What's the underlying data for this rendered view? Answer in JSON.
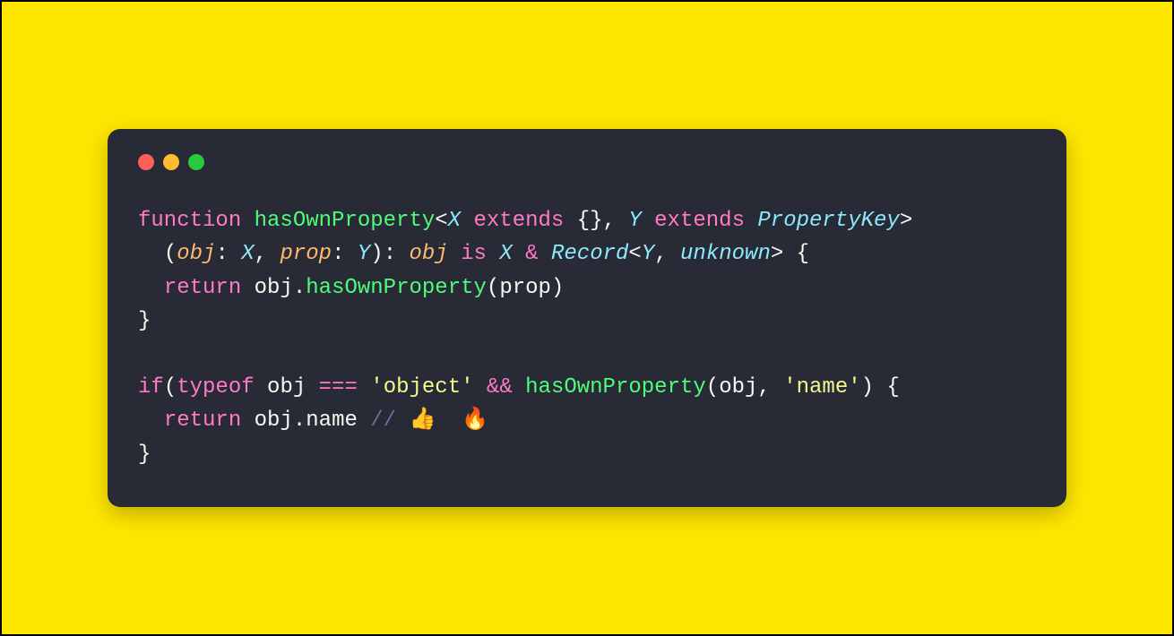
{
  "window": {
    "buttons": [
      "close",
      "minimize",
      "zoom"
    ]
  },
  "code": {
    "line1": {
      "kw_function": "function",
      "fn_name": "hasOwnProperty",
      "lt1": "<",
      "type_X": "X",
      "kw_extends1": "extends",
      "braces1": "{}",
      "comma1": ",",
      "type_Y": "Y",
      "kw_extends2": "extends",
      "type_PropertyKey": "PropertyKey",
      "gt1": ">"
    },
    "line2": {
      "indent": "  ",
      "lparen": "(",
      "var_obj": "obj",
      "colon1": ":",
      "type_X": "X",
      "comma": ",",
      "var_prop": "prop",
      "colon2": ":",
      "type_Y": "Y",
      "rparen_colon": "):",
      "var_obj2": "obj",
      "kw_is": "is",
      "type_X2": "X",
      "amp": "&",
      "type_Record": "Record",
      "lt": "<",
      "type_Y2": "Y",
      "comma2": ",",
      "type_unknown": "unknown",
      "gt": ">",
      "lbrace": "{"
    },
    "line3": {
      "indent": "  ",
      "kw_return": "return",
      "obj": "obj",
      "dot": ".",
      "method": "hasOwnProperty",
      "lparen": "(",
      "arg": "prop",
      "rparen": ")"
    },
    "line4": {
      "rbrace": "}"
    },
    "line6": {
      "kw_if": "if",
      "lparen": "(",
      "kw_typeof": "typeof",
      "obj": "obj",
      "op_eq": "===",
      "str_object": "'object'",
      "op_and": "&&",
      "fn_call": "hasOwnProperty",
      "lparen2": "(",
      "arg1": "obj",
      "comma": ",",
      "str_name": "'name'",
      "rparen2": ")",
      "lbrace": "{"
    },
    "line7": {
      "indent": "  ",
      "kw_return": "return",
      "obj": "obj",
      "dot": ".",
      "prop": "name",
      "comment": "// 👍  🔥"
    },
    "line8": {
      "rbrace": "}"
    }
  }
}
